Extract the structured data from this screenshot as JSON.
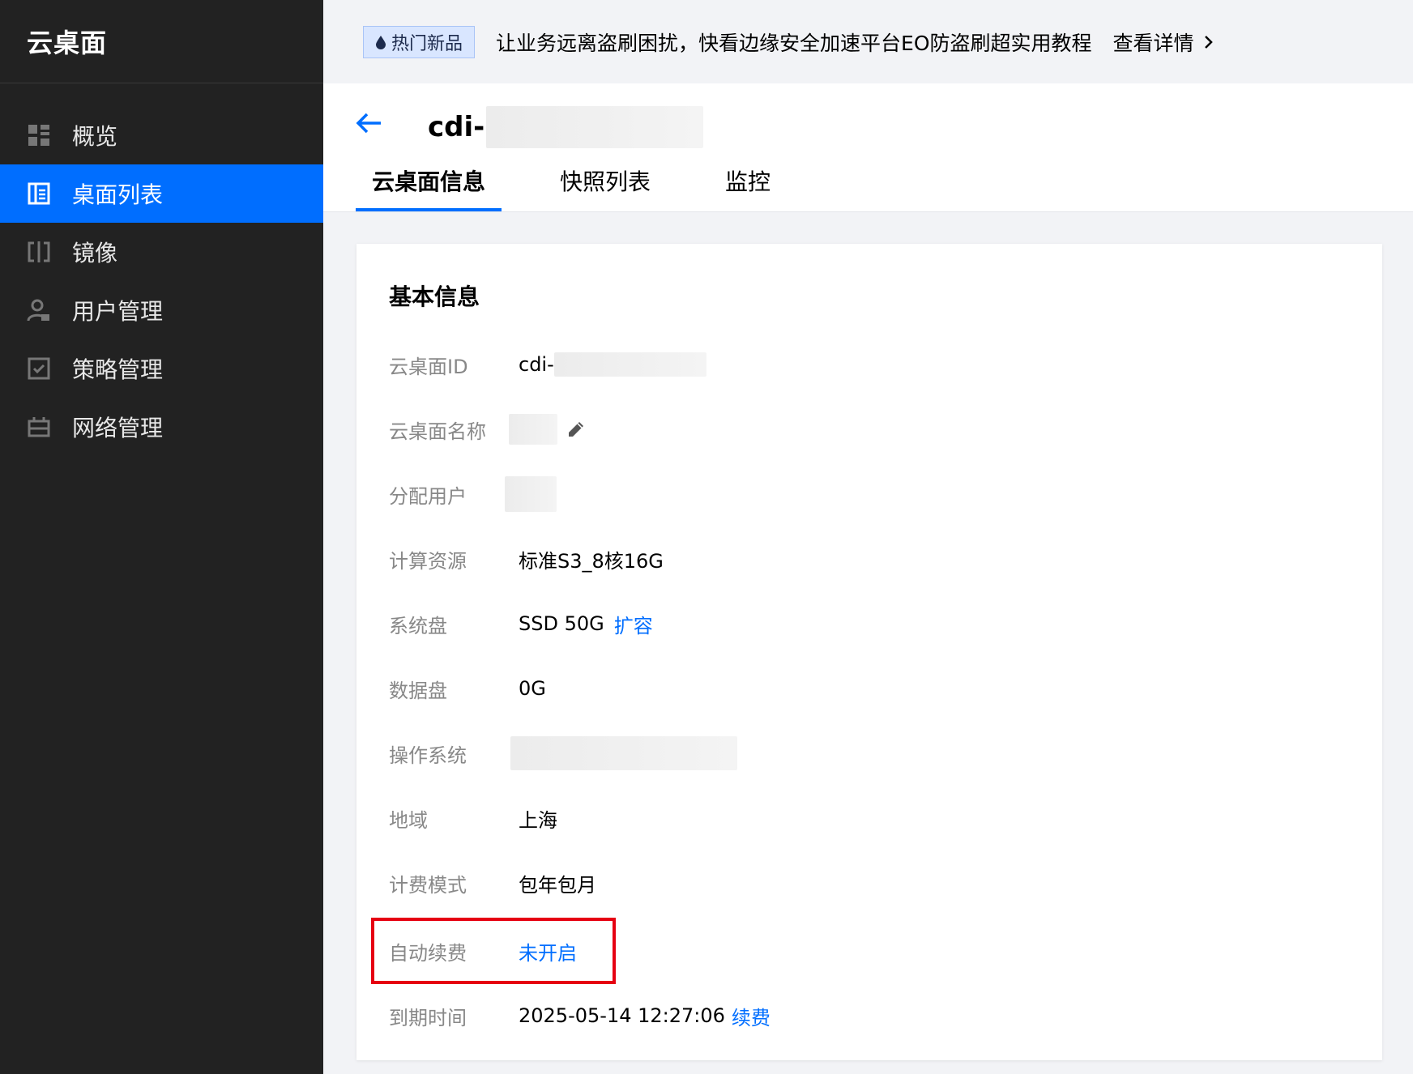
{
  "sidebar": {
    "brand": "云桌面",
    "items": [
      {
        "label": "概览",
        "icon": "grid-icon"
      },
      {
        "label": "桌面列表",
        "icon": "desktop-list-icon"
      },
      {
        "label": "镜像",
        "icon": "mirror-icon"
      },
      {
        "label": "用户管理",
        "icon": "user-management-icon"
      },
      {
        "label": "策略管理",
        "icon": "policy-icon"
      },
      {
        "label": "网络管理",
        "icon": "network-icon"
      }
    ],
    "active_index": 1
  },
  "banner": {
    "badge": "热门新品",
    "message": "让业务远离盗刷困扰，快看边缘安全加速平台EO防盗刷超实用教程",
    "more": "查看详情"
  },
  "header": {
    "title": "cdi-",
    "tabs": [
      "云桌面信息",
      "快照列表",
      "监控"
    ],
    "active_tab": 0
  },
  "info": {
    "section_title": "基本信息",
    "rows": [
      {
        "label": "云桌面ID",
        "value": "cdi-"
      },
      {
        "label": "云桌面名称",
        "value": ""
      },
      {
        "label": "分配用户",
        "value": ""
      },
      {
        "label": "计算资源",
        "value": "标准S3_8核16G"
      },
      {
        "label": "系统盘",
        "value": "SSD 50G",
        "link": "扩容"
      },
      {
        "label": "数据盘",
        "value": "0G"
      },
      {
        "label": "操作系统",
        "value": ""
      },
      {
        "label": "地域",
        "value": "上海"
      },
      {
        "label": "计费模式",
        "value": "包年包月"
      },
      {
        "label": "自动续费",
        "link": "未开启"
      },
      {
        "label": "到期时间",
        "value": "2025-05-14 12:27:06",
        "link": "续费"
      }
    ]
  },
  "colors": {
    "accent": "#006eff",
    "sidebar_bg": "#222222",
    "highlight": "#e60012"
  }
}
